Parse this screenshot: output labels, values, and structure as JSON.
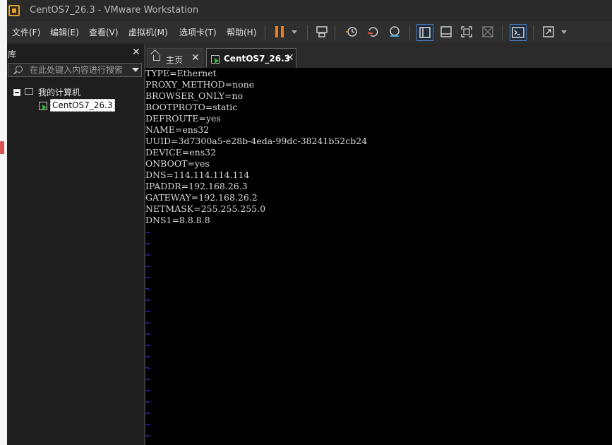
{
  "window": {
    "title": "CentOS7_26.3 - VMware Workstation"
  },
  "menu": [
    {
      "label": "文件(F)"
    },
    {
      "label": "编辑(E)"
    },
    {
      "label": "查看(V)"
    },
    {
      "label": "虚拟机(M)"
    },
    {
      "label": "选项卡(T)"
    },
    {
      "label": "帮助(H)"
    }
  ],
  "toolbar": {
    "icons": [
      "pause-icon",
      "send-ctrl-alt-del-icon",
      "snapshot-icon",
      "revert-snapshot-icon",
      "snapshot-manager-icon",
      "show-library-icon",
      "thumbnail-bar-icon",
      "fullscreen-icon",
      "unity-icon",
      "console-view-icon",
      "stretch-icon"
    ]
  },
  "library": {
    "title": "库",
    "close": "✕",
    "search_placeholder": "在此处键入内容进行搜索",
    "tree": {
      "root_label": "我的计算机",
      "vm_label": "CentOS7_26.3"
    }
  },
  "tabs": [
    {
      "label": "主页",
      "close": "✕"
    },
    {
      "label": "CentOS7_26.3",
      "close": "✕"
    }
  ],
  "terminal": {
    "lines": [
      "TYPE=Ethernet",
      "PROXY_METHOD=none",
      "BROWSER_ONLY=no",
      "BOOTPROTO=static",
      "DEFROUTE=yes",
      "NAME=ens32",
      "UUID=3d7300a5-e28b-4eda-99dc-38241b52cb24",
      "DEVICE=ens32",
      "ONBOOT=yes",
      "DNS=114.114.114.114",
      "IPADDR=192.168.26.3",
      "GATEWAY=192.168.26.2",
      "NETMASK=255.255.255.0",
      "DNS1=8.8.8.8"
    ],
    "tilde_count": 20,
    "tilde_char": "~"
  },
  "colors": {
    "accent": "#f07d1a",
    "terminal_bg": "#000000",
    "terminal_text": "#d9d9d9",
    "tilde": "#3b3bff"
  }
}
